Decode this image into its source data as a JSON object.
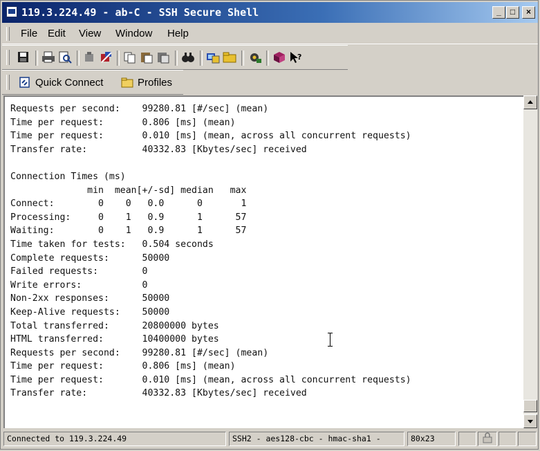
{
  "window": {
    "title": "119.3.224.49 - ab-C - SSH Secure Shell",
    "controls": {
      "minimize": "_",
      "maximize": "□",
      "close": "×"
    }
  },
  "menu": [
    "File",
    "Edit",
    "View",
    "Window",
    "Help"
  ],
  "toolbar": {
    "buttons": [
      "save-icon",
      "print-icon",
      "print-preview-icon",
      "disconnect-icon",
      "reconnect-icon",
      "copy-icon",
      "paste-icon",
      "paste-special-icon",
      "find-icon",
      "new-session-icon",
      "open-folder-icon",
      "settings-icon",
      "help-book-icon",
      "whats-this-icon"
    ]
  },
  "quickbar": {
    "quick_connect": "Quick Connect",
    "profiles": "Profiles"
  },
  "terminal": {
    "lines": [
      "Requests per second:    99280.81 [#/sec] (mean)",
      "Time per request:       0.806 [ms] (mean)",
      "Time per request:       0.010 [ms] (mean, across all concurrent requests)",
      "Transfer rate:          40332.83 [Kbytes/sec] received",
      "",
      "Connection Times (ms)",
      "              min  mean[+/-sd] median   max",
      "Connect:        0    0   0.0      0       1",
      "Processing:     0    1   0.9      1      57",
      "Waiting:        0    1   0.9      1      57",
      "Time taken for tests:   0.504 seconds",
      "Complete requests:      50000",
      "Failed requests:        0",
      "Write errors:           0",
      "Non-2xx responses:      50000",
      "Keep-Alive requests:    50000",
      "Total transferred:      20800000 bytes",
      "HTML transferred:       10400000 bytes",
      "Requests per second:    99280.81 [#/sec] (mean)",
      "Time per request:       0.806 [ms] (mean)",
      "Time per request:       0.010 [ms] (mean, across all concurrent requests)",
      "Transfer rate:          40332.83 [Kbytes/sec] received"
    ]
  },
  "status": {
    "connection": "Connected to 119.3.224.49",
    "cipher": "SSH2 - aes128-cbc - hmac-sha1 -",
    "size": "80x23"
  }
}
